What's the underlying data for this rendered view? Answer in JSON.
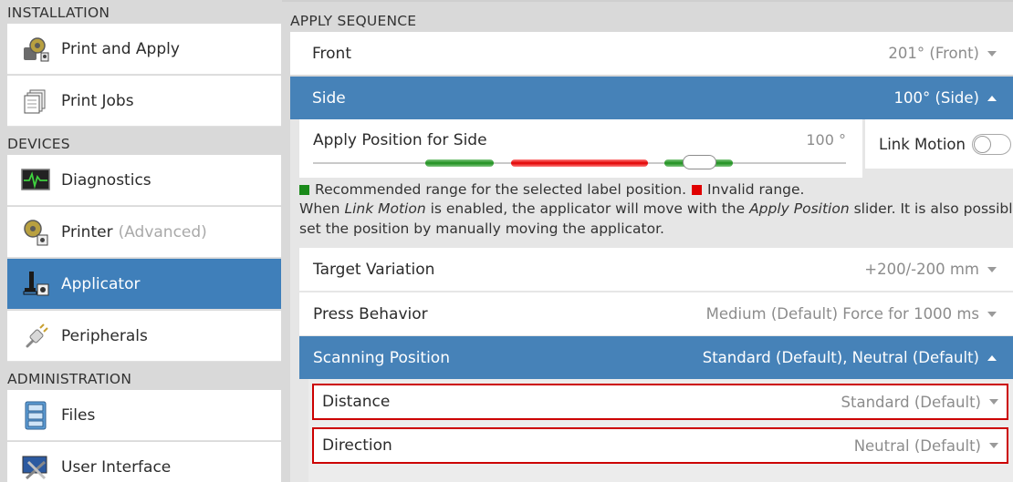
{
  "sidebar": {
    "sections": [
      {
        "title": "INSTALLATION"
      },
      {
        "title": "DEVICES"
      },
      {
        "title": "ADMINISTRATION"
      }
    ],
    "items": [
      {
        "label": "Print and Apply",
        "sub": ""
      },
      {
        "label": "Print Jobs",
        "sub": ""
      },
      {
        "label": "Diagnostics",
        "sub": ""
      },
      {
        "label": "Printer",
        "sub": "(Advanced)"
      },
      {
        "label": "Applicator",
        "sub": ""
      },
      {
        "label": "Peripherals",
        "sub": ""
      },
      {
        "label": "Files",
        "sub": ""
      },
      {
        "label": "User Interface",
        "sub": ""
      }
    ]
  },
  "main": {
    "header": "APPLY SEQUENCE",
    "front": {
      "label": "Front",
      "value": "201° (Front)"
    },
    "side": {
      "label": "Side",
      "value": "100° (Side)"
    },
    "slider": {
      "label": "Apply Position for Side",
      "value": "100 °",
      "position_fraction": 0.726
    },
    "link_motion": {
      "label": "Link Motion",
      "enabled": false
    },
    "legend": {
      "recommended": "Recommended range for the selected label position.",
      "invalid": "Invalid range.",
      "info_pre": "When ",
      "info_em1": "Link Motion",
      "info_mid": " is enabled, the applicator will move with the ",
      "info_em2": "Apply Position",
      "info_post": " slider. It is also possible to",
      "info_line2": "set the position by manually moving the applicator."
    },
    "target_variation": {
      "label": "Target Variation",
      "value": "+200/-200 mm"
    },
    "press_behavior": {
      "label": "Press Behavior",
      "value": "Medium (Default) Force for 1000 ms"
    },
    "scanning_position": {
      "label": "Scanning Position",
      "value": "Standard (Default), Neutral (Default)"
    },
    "distance": {
      "label": "Distance",
      "value": "Standard (Default)"
    },
    "direction": {
      "label": "Direction",
      "value": "Neutral (Default)"
    }
  },
  "colors": {
    "accent": "#4682b8",
    "active_nav": "#3f7fba",
    "recommended": "#1a8a1a",
    "invalid": "#e00000",
    "highlight": "#cc0000"
  }
}
